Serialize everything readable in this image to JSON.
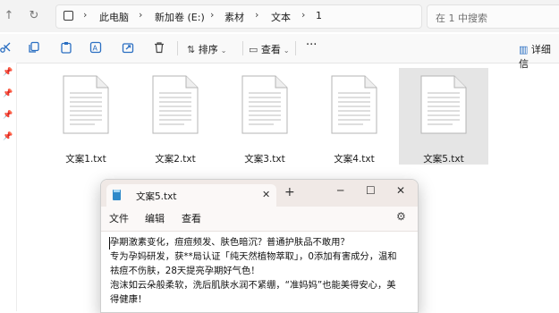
{
  "navbar": {
    "back_icon": "arrow-left-icon",
    "forward_icon": "arrow-right-icon",
    "up_icon": "arrow-up-icon",
    "refresh_icon": "refresh-icon",
    "breadcrumb": [
      "此电脑",
      "新加卷 (E:)",
      "素材",
      "文本",
      "1"
    ],
    "search_placeholder": "在 1 中搜索"
  },
  "toolbar": {
    "sort_label": "排序",
    "view_label": "查看",
    "more_label": "···",
    "details_label": "详细信"
  },
  "files": [
    {
      "name": "文案1.txt",
      "selected": false
    },
    {
      "name": "文案2.txt",
      "selected": false
    },
    {
      "name": "文案3.txt",
      "selected": false
    },
    {
      "name": "文案4.txt",
      "selected": false
    },
    {
      "name": "文案5.txt",
      "selected": true
    }
  ],
  "notepad": {
    "tab_title": "文案5.txt",
    "menu": {
      "file": "文件",
      "edit": "编辑",
      "view": "查看"
    },
    "content_lines": [
      "孕期激素变化，痘痘频发、肤色暗沉？普通护肤品不敢用？",
      "专为孕妈研发，获**局认证「纯天然植物萃取」，0添加有害成分，温和",
      "祛痘不伤肤，28天提亮孕期好气色！",
      "泡沫如云朵般柔软，洗后肌肤水润不紧绷，“准妈妈”也能美得安心，美",
      "得健康！"
    ]
  },
  "colors": {
    "accent_blue": "#2e89c9",
    "selected_bg": "#e5e5e5",
    "titlebar_bg": "#f0e9e6"
  }
}
